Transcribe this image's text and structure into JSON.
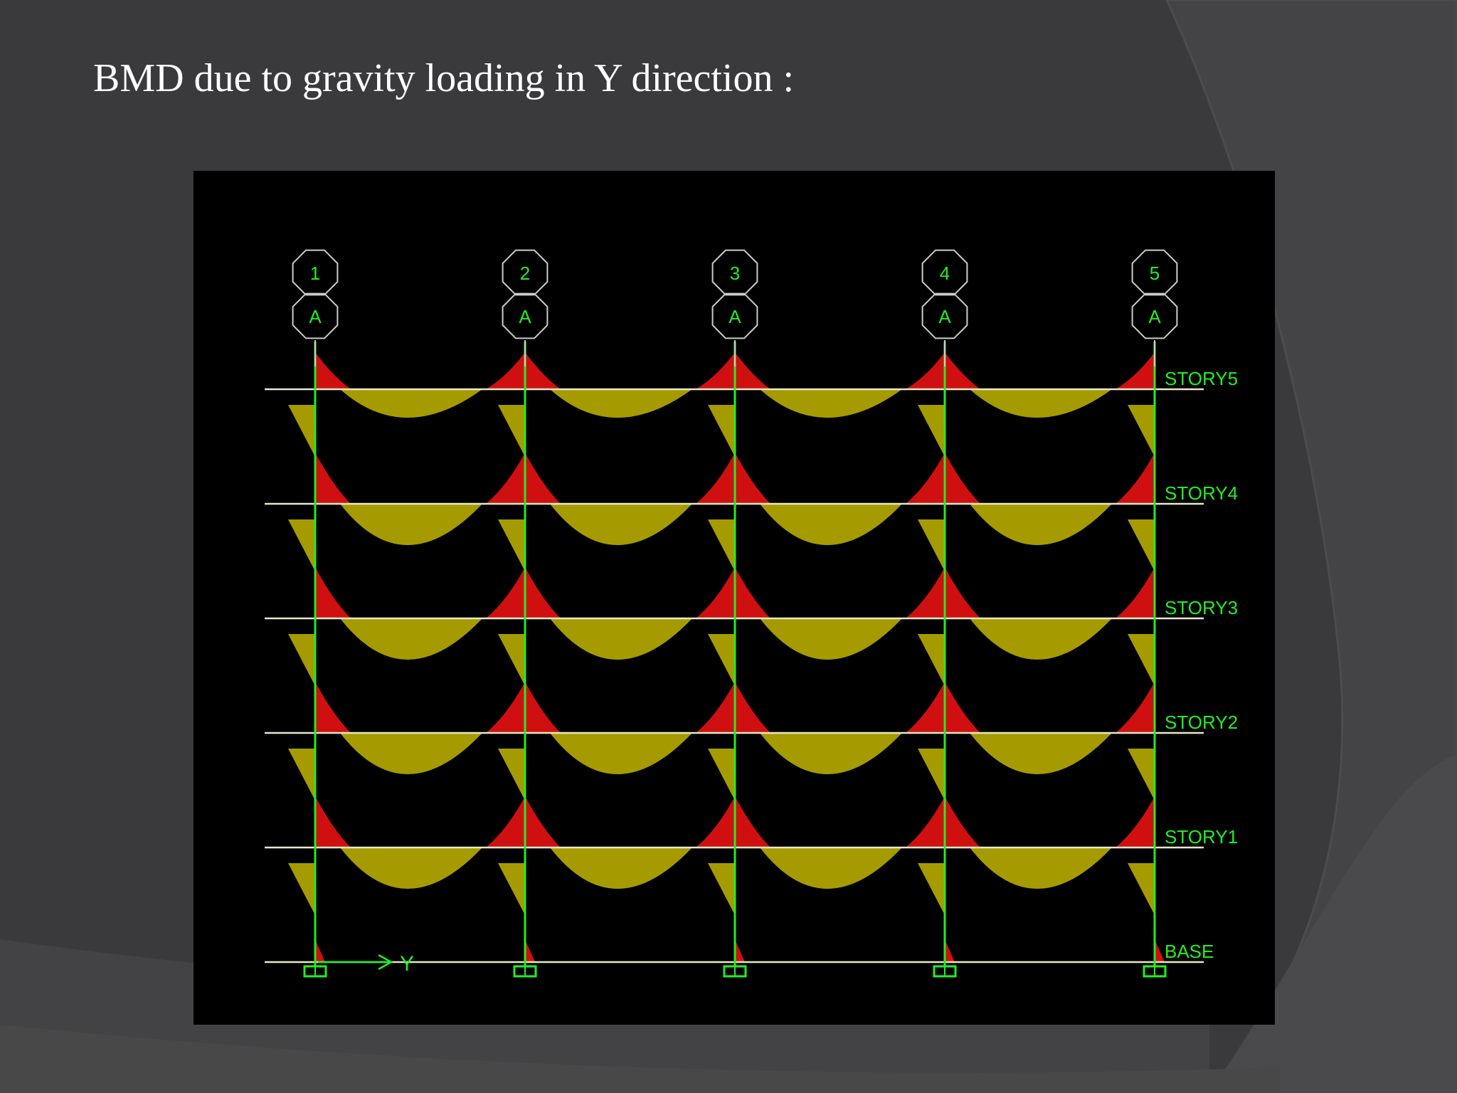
{
  "slide": {
    "title": "BMD due to gravity loading in Y direction :"
  },
  "diagram": {
    "grid_lines": [
      "1",
      "2",
      "3",
      "4",
      "5"
    ],
    "grid_row_label": "A",
    "stories": [
      "STORY5",
      "STORY4",
      "STORY3",
      "STORY2",
      "STORY1",
      "BASE"
    ],
    "axis_label": "Y",
    "colors": {
      "background": "#000000",
      "column": "#22ee22",
      "beam": "#e8e8c8",
      "sagging_moment": "#a59b00",
      "hogging_moment": "#d01010",
      "column_moment": "#a59b00",
      "labels": "#22ee22"
    }
  }
}
